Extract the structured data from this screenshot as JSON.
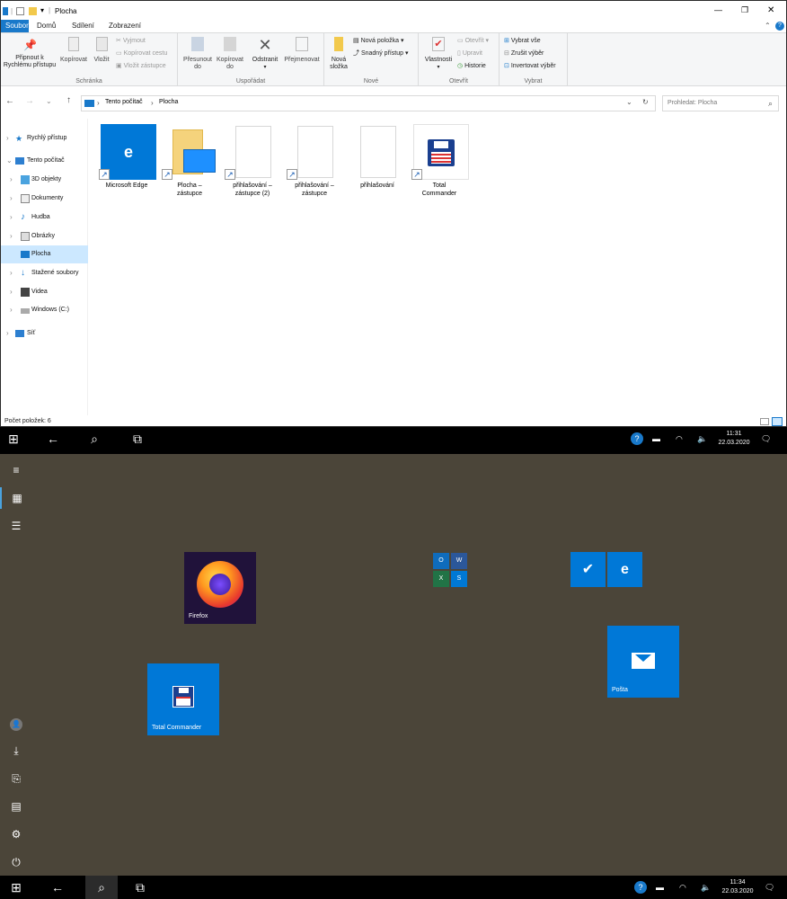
{
  "explorer": {
    "window_title": "Plocha",
    "window_controls": {
      "minimize": "—",
      "maximize": "❐",
      "close": "✕"
    },
    "ribbon_tabs": [
      {
        "label": "Soubor",
        "active": true
      },
      {
        "label": "Domů",
        "active": false
      },
      {
        "label": "Sdílení",
        "active": false
      },
      {
        "label": "Zobrazení",
        "active": false
      }
    ],
    "ribbon": {
      "clipboard": {
        "group_label": "Schránka",
        "pin_line1": "Připnout k",
        "pin_line2": "Rychlému přístupu",
        "copy": "Kopírovat",
        "paste": "Vložit",
        "cut": "Vyjmout",
        "copy_path": "Kopírovat cestu",
        "paste_shortcut": "Vložit zástupce"
      },
      "organize": {
        "group_label": "Uspořádat",
        "move_line1": "Přesunout",
        "move_line2": "do",
        "copyto_line1": "Kopírovat",
        "copyto_line2": "do",
        "delete": "Odstranit",
        "rename": "Přejmenovat"
      },
      "new": {
        "group_label": "Nové",
        "newfolder_line1": "Nová",
        "newfolder_line2": "složka",
        "new_item": "Nová položka",
        "easy_access": "Snadný přístup"
      },
      "open": {
        "group_label": "Otevřít",
        "properties": "Vlastnosti",
        "open": "Otevřít",
        "edit": "Upravit",
        "history": "Historie"
      },
      "select": {
        "group_label": "Vybrat",
        "select_all": "Vybrat vše",
        "select_none": "Zrušit výběr",
        "invert": "Invertovat výběr"
      }
    },
    "address": {
      "crumb1": "Tento počítač",
      "crumb2": "Plocha",
      "search_placeholder": "Prohledat: Plocha"
    },
    "nav": [
      {
        "label": "Rychlý přístup",
        "icon": "star-icon"
      },
      {
        "label": "Tento počítač",
        "icon": "computer-icon"
      },
      {
        "label": "3D objekty",
        "icon": "cube-icon"
      },
      {
        "label": "Dokumenty",
        "icon": "documents-icon"
      },
      {
        "label": "Hudba",
        "icon": "music-icon"
      },
      {
        "label": "Obrázky",
        "icon": "pictures-icon"
      },
      {
        "label": "Plocha",
        "icon": "desktop-icon"
      },
      {
        "label": "Stažené soubory",
        "icon": "download-icon"
      },
      {
        "label": "Videa",
        "icon": "video-icon"
      },
      {
        "label": "Windows (C:)",
        "icon": "drive-icon"
      },
      {
        "label": "Síť",
        "icon": "network-icon"
      }
    ],
    "files": [
      {
        "line1": "Microsoft Edge",
        "line2": ""
      },
      {
        "line1": "Plocha –",
        "line2": "zástupce"
      },
      {
        "line1": "přihlašování –",
        "line2": "zástupce (2)"
      },
      {
        "line1": "přihlašování –",
        "line2": "zástupce"
      },
      {
        "line1": "přihlašování",
        "line2": ""
      },
      {
        "line1": "Total",
        "line2": "Commander"
      }
    ],
    "status": "Počet položek: 6"
  },
  "taskbar1": {
    "time": "11:31",
    "date": "22.03.2020"
  },
  "start": {
    "tiles": {
      "firefox": "Firefox",
      "total_commander": "Total Commander",
      "mail": "Pošta"
    }
  },
  "taskbar2": {
    "time": "11:34",
    "date": "22.03.2020"
  },
  "colors": {
    "accent": "#1979ca",
    "tile_blue": "#0078d7",
    "start_bg": "#4b4539",
    "firefox_bg": "#20123a"
  }
}
